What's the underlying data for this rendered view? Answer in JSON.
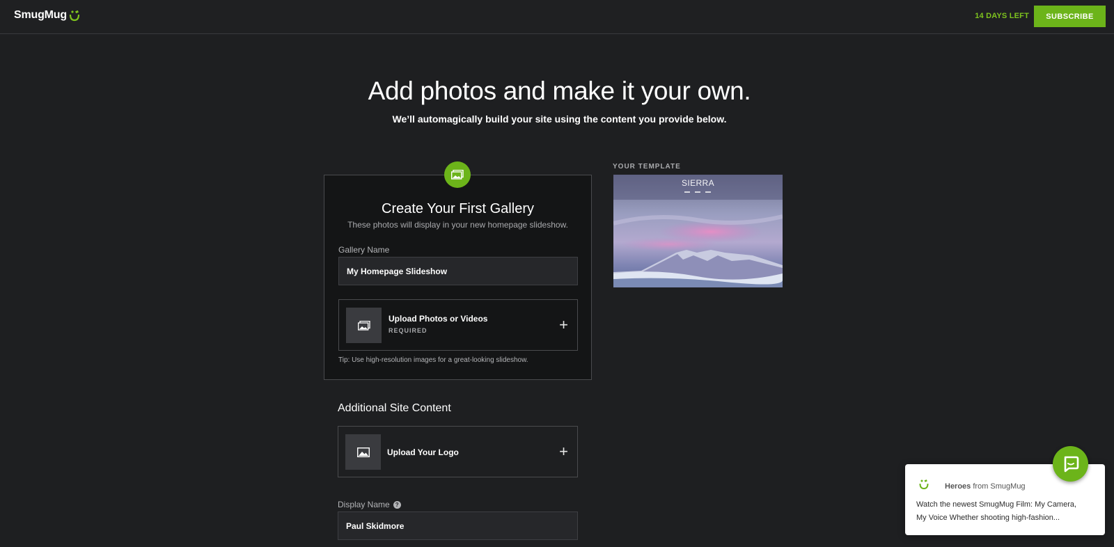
{
  "header": {
    "brand": "SmugMug",
    "trial_status": "14 DAYS LEFT",
    "subscribe_label": "SUBSCRIBE"
  },
  "hero": {
    "title": "Add photos and make it your own.",
    "subtitle": "We’ll automagically build your site using the content you provide below."
  },
  "gallery_card": {
    "title": "Create Your First Gallery",
    "subtitle": "These photos will display in your new homepage slideshow.",
    "gallery_name_label": "Gallery Name",
    "gallery_name_value": "My Homepage Slideshow",
    "upload_title": "Upload Photos or Videos",
    "upload_required": "REQUIRED",
    "tip": "Tip: Use high-resolution images for a great-looking slideshow."
  },
  "template": {
    "label": "YOUR TEMPLATE",
    "name": "SIERRA"
  },
  "additional": {
    "title": "Additional Site Content",
    "logo_label": "Upload Your Logo",
    "display_name_label": "Display Name",
    "display_name_value": "Paul Skidmore"
  },
  "chat": {
    "sender_name": "Heroes",
    "sender_suffix": "from SmugMug",
    "message": "Watch the newest SmugMug Film: My Camera, My Voice Whether shooting high-fashion..."
  },
  "colors": {
    "accent": "#6cb41a",
    "background": "#1e1f21",
    "card": "#141516"
  },
  "icons": [
    "smugmug-smile-icon",
    "gallery-icon",
    "photos-icon",
    "plus-icon",
    "image-icon",
    "help-icon",
    "chat-icon"
  ]
}
